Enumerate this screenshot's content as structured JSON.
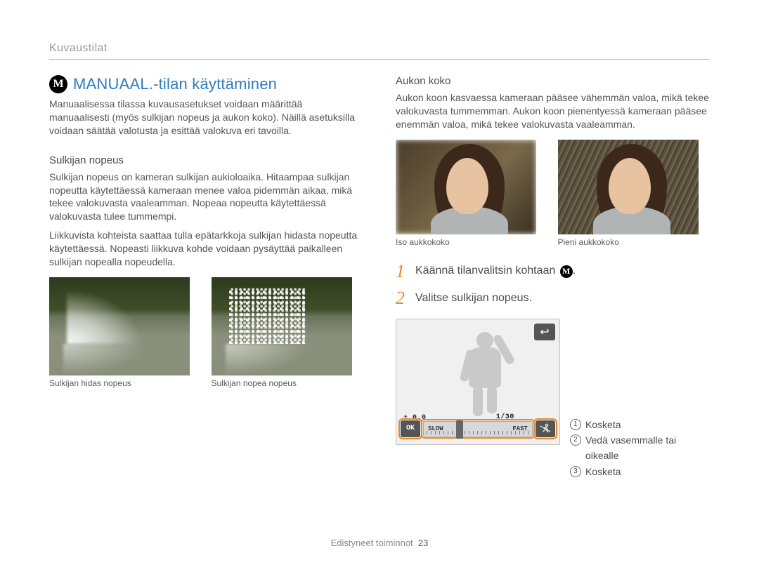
{
  "header": "Kuvaustilat",
  "title": "MANUAAL.-tilan käyttäminen",
  "mode_letter": "M",
  "intro": "Manuaalisessa tilassa kuvausasetukset voidaan määrittää manuaalisesti (myös sulkijan nopeus ja aukon koko). Näillä asetuksilla voidaan säätää valotusta ja esittää valokuva eri tavoilla.",
  "left": {
    "sub": "Sulkijan nopeus",
    "p1": "Sulkijan nopeus on kameran sulkijan aukioloaika. Hitaampaa sulkijan nopeutta käytettäessä kameraan menee valoa pidemmän aikaa, mikä tekee valokuvasta vaaleamman. Nopeaa nopeutta käytettäessä valokuvasta tulee tummempi.",
    "p2": "Liikkuvista kohteista saattaa tulla epätarkkoja sulkijan hidasta nopeutta käytettäessä. Nopeasti liikkuva kohde voidaan pysäyttää paikalleen sulkijan nopealla nopeudella.",
    "cap1": "Sulkijan hidas nopeus",
    "cap2": "Sulkijan nopea nopeus"
  },
  "right": {
    "sub": "Aukon koko",
    "p1": "Aukon koon kasvaessa kameraan pääsee vähemmän valoa, mikä tekee valokuvasta tummemman. Aukon koon pienentyessä kameraan pääsee enemmän valoa, mikä tekee valokuvasta vaaleamman.",
    "cap1": "Iso aukkokoko",
    "cap2": "Pieni aukkokoko",
    "step1": "Käännä tilanvalitsin kohtaan",
    "step1_end": ".",
    "step2": "Valitse sulkijan nopeus.",
    "screen": {
      "ev": "0.0",
      "shutter": "1/30",
      "ok": "OK",
      "slow": "SLOW",
      "fast": "FAST",
      "back": "↩"
    },
    "legend": {
      "l1": "Kosketa",
      "l2": "Vedä vasemmalle tai oikealle",
      "l3": "Kosketa"
    }
  },
  "footer": {
    "section": "Edistyneet toiminnot",
    "page": "23"
  }
}
